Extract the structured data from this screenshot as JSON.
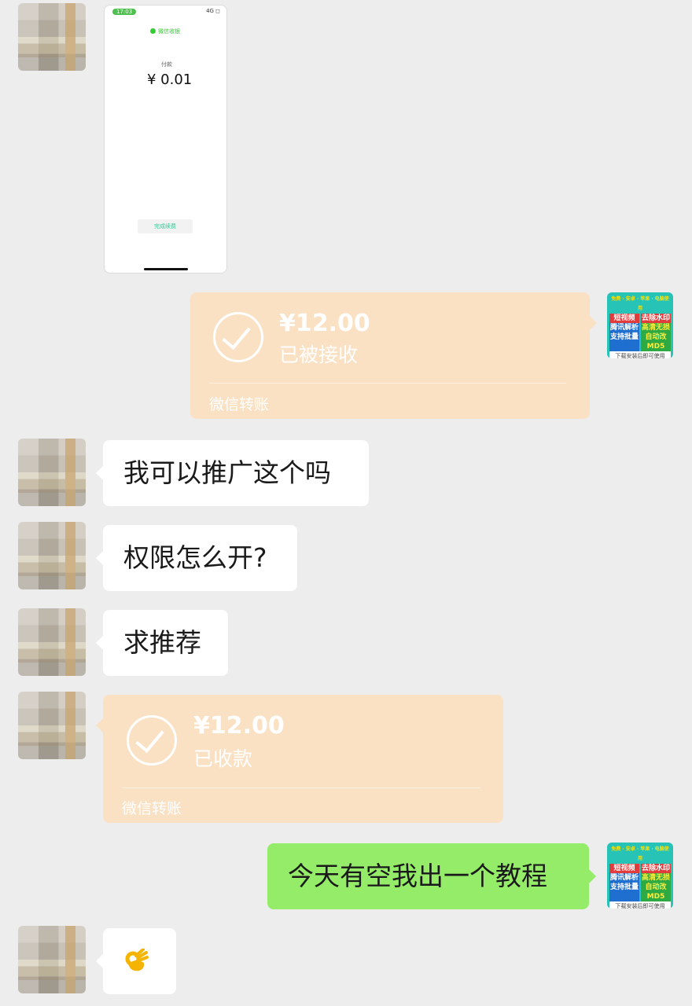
{
  "messages": {
    "screenshot": {
      "time": "17:03",
      "status": "4G ◻",
      "title": "微信收银",
      "label": "付款",
      "amount": "¥ 0.01",
      "button": "完成续费"
    },
    "transfer_sent": {
      "amount": "¥12.00",
      "status": "已被接收",
      "footer": "微信转账"
    },
    "text1": "我可以推广这个吗",
    "text2": "权限怎么开?",
    "text3": "求推荐",
    "transfer_received": {
      "amount": "¥12.00",
      "status": "已收款",
      "footer": "微信转账"
    },
    "reply": "今天有空我出一个教程",
    "emoji": "ok-hand-emoji"
  },
  "my_avatar": {
    "row1": "免费 · 安卓 · 苹果 · 电脑使用",
    "row2a": "短视频",
    "row2b": "去除水印",
    "row3a": "腾讯解析",
    "row3b": "高清无损",
    "row4a": "支持批量",
    "row4b": "自动改MD5",
    "row5": "下载安装后即可使用"
  },
  "colors": {
    "background": "#ededed",
    "transfer_bubble": "#fbe1c4",
    "my_bubble": "#95ec69",
    "their_bubble": "#ffffff"
  }
}
